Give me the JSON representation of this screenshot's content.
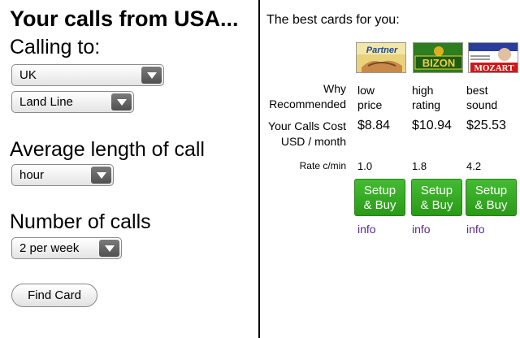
{
  "left": {
    "headline": "Your calls from USA...",
    "calling_to_label": "Calling to:",
    "country_select": "UK",
    "line_type_select": "Land Line",
    "avg_length_label": "Average length of call",
    "avg_length_select": "hour",
    "num_calls_label": "Number of calls",
    "num_calls_select": "2 per week",
    "find_button": "Find Card"
  },
  "right": {
    "title": "The best cards for you:",
    "row_labels": {
      "why_1": "Why",
      "why_2": "Recommended",
      "cost_1": "Your Calls Cost",
      "cost_2": "USD / month",
      "rate": "Rate c/min"
    },
    "cards": [
      {
        "logo_text": "Partner",
        "reason_1": "low",
        "reason_2": "price",
        "cost": "$8.84",
        "rate": "1.0",
        "buy_1": "Setup",
        "buy_2": "& Buy",
        "info": "info"
      },
      {
        "logo_text": "BIZON",
        "reason_1": "high",
        "reason_2": "rating",
        "cost": "$10.94",
        "rate": "1.8",
        "buy_1": "Setup",
        "buy_2": "& Buy",
        "info": "info"
      },
      {
        "logo_text": "MOZART",
        "reason_1": "best",
        "reason_2": "sound",
        "cost": "$25.53",
        "rate": "4.2",
        "buy_1": "Setup",
        "buy_2": "& Buy",
        "info": "info"
      }
    ]
  },
  "colors": {
    "buy_green": "#34a822",
    "info_link": "#5a2a8c"
  }
}
